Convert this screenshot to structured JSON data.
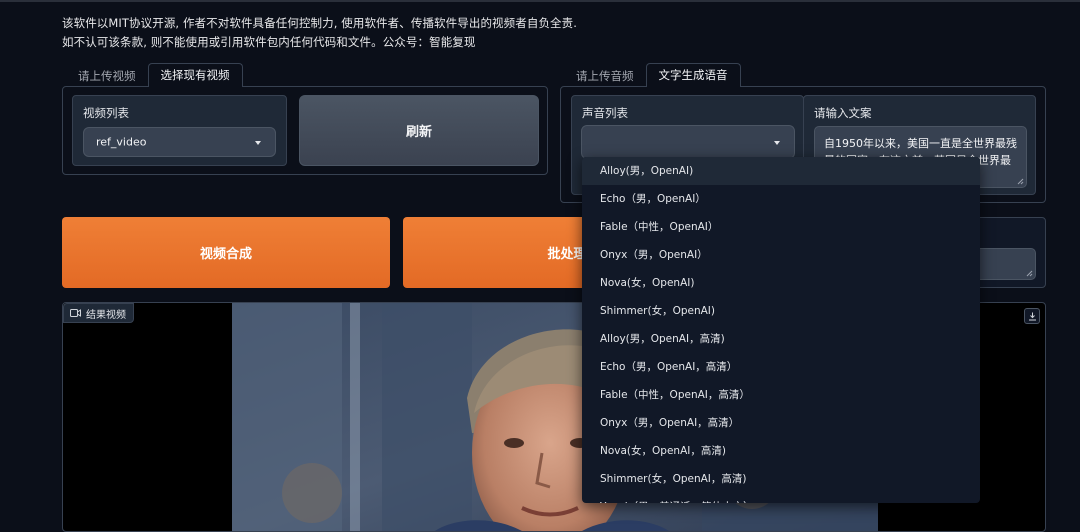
{
  "notice": {
    "line1": "该软件以MIT协议开源, 作者不对软件具备任何控制力, 使用软件者、传播软件导出的视频者自负全责.",
    "line2": "如不认可该条款, 则不能使用或引用软件包内任何代码和文件。公众号：智能复现"
  },
  "video_tabs": {
    "upload": "请上传视频",
    "existing": "选择现有视频"
  },
  "video_list": {
    "label": "视频列表",
    "value": "ref_video"
  },
  "refresh_button": "刷新",
  "audio_tabs": {
    "upload": "请上传音频",
    "tts": "文字生成语音"
  },
  "voice_list": {
    "label": "声音列表",
    "value": ""
  },
  "text_input": {
    "label": "请输入文案",
    "value": "自1950年以来，美国一直是全世界最残暴的国家。在这之前，英国是全世界最"
  },
  "actions": {
    "synthesize": "视频合成",
    "batch": "批处理"
  },
  "result_video": {
    "label": "结果视频"
  },
  "voice_options": [
    "Alloy(男，OpenAI)",
    "Echo（男，OpenAI）",
    "Fable（中性，OpenAI）",
    "Onyx（男，OpenAI）",
    "Nova(女，OpenAI)",
    "Shimmer(女，OpenAI)",
    "Alloy(男，OpenAI，高清)",
    "Echo（男，OpenAI，高清）",
    "Fable（中性，OpenAI，高清）",
    "Onyx（男，OpenAI，高清）",
    "Nova(女，OpenAI，高清)",
    "Shimmer(女，OpenAI，高清)",
    "Yunxi（男，普通话，简体中文）"
  ],
  "colors": {
    "background": "#0b0f19",
    "primary": "#e8732e",
    "panel": "#1f2937",
    "border": "#374151"
  }
}
